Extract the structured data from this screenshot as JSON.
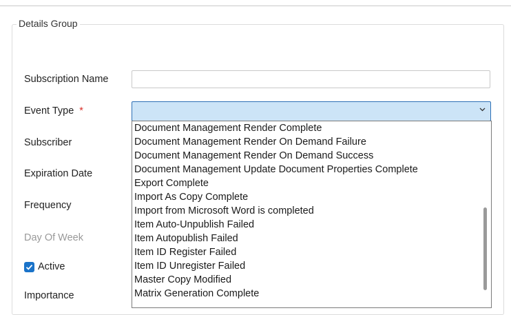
{
  "group": {
    "legend": "Details Group"
  },
  "fields": {
    "subscription_name": {
      "label": "Subscription Name",
      "value": ""
    },
    "event_type": {
      "label": "Event Type",
      "required_mark": "*",
      "value": ""
    },
    "subscriber": {
      "label": "Subscriber"
    },
    "expiration_date": {
      "label": "Expiration Date"
    },
    "frequency": {
      "label": "Frequency"
    },
    "day_of_week": {
      "label": "Day Of Week"
    },
    "active": {
      "label": "Active",
      "checked": true
    },
    "importance": {
      "label": "Importance"
    }
  },
  "dropdown": {
    "options": [
      "Document Management Render Complete",
      "Document Management Render On Demand Failure",
      "Document Management Render On Demand Success",
      "Document Management Update Document Properties Complete",
      "Export Complete",
      "Import As Copy Complete",
      "Import from Microsoft Word is completed",
      "Item Auto-Unpublish Failed",
      "Item Autopublish Failed",
      "Item ID Register Failed",
      "Item ID Unregister Failed",
      "Master Copy Modified",
      "Matrix Generation Complete"
    ]
  },
  "colors": {
    "accent": "#1a73c9",
    "select_bg": "#cce4f7",
    "required": "#d9312b"
  },
  "icons": {
    "select_arrow": "chevron-down-icon",
    "checkbox": "check-icon"
  }
}
